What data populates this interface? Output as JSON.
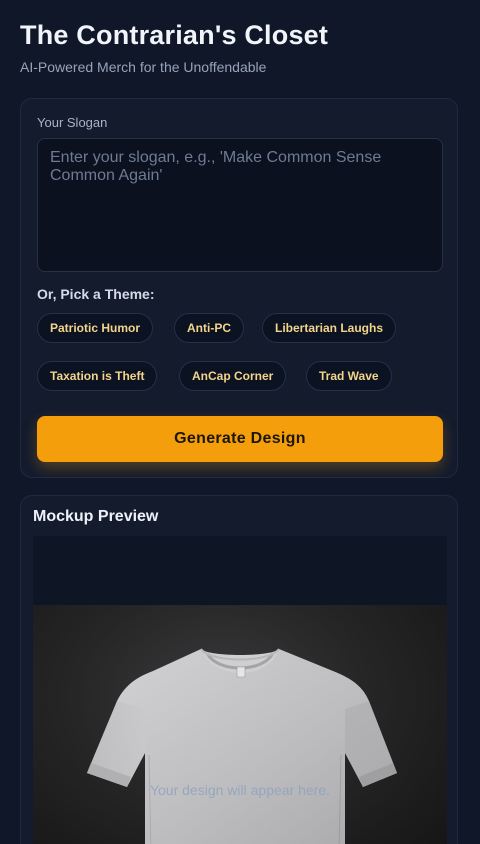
{
  "header": {
    "title": "The Contrarian's Closet",
    "subtitle": "AI-Powered Merch for the Unoffendable"
  },
  "form": {
    "slogan_label": "Your Slogan",
    "slogan_value": "",
    "slogan_placeholder": "Enter your slogan, e.g., 'Make Common Sense Common Again'",
    "theme_label": "Or, Pick a Theme:",
    "themes": [
      "Patriotic Humor",
      "Anti-PC",
      "Libertarian Laughs",
      "Taxation is Theft",
      "AnCap Corner",
      "Trad Wave"
    ],
    "generate_label": "Generate Design"
  },
  "preview": {
    "title": "Mockup Preview",
    "placeholder": "Your design will appear here."
  },
  "colors": {
    "background": "#101729",
    "card": "#131b2d",
    "accent": "#f59e0b",
    "chip_text": "#f4d48a"
  }
}
